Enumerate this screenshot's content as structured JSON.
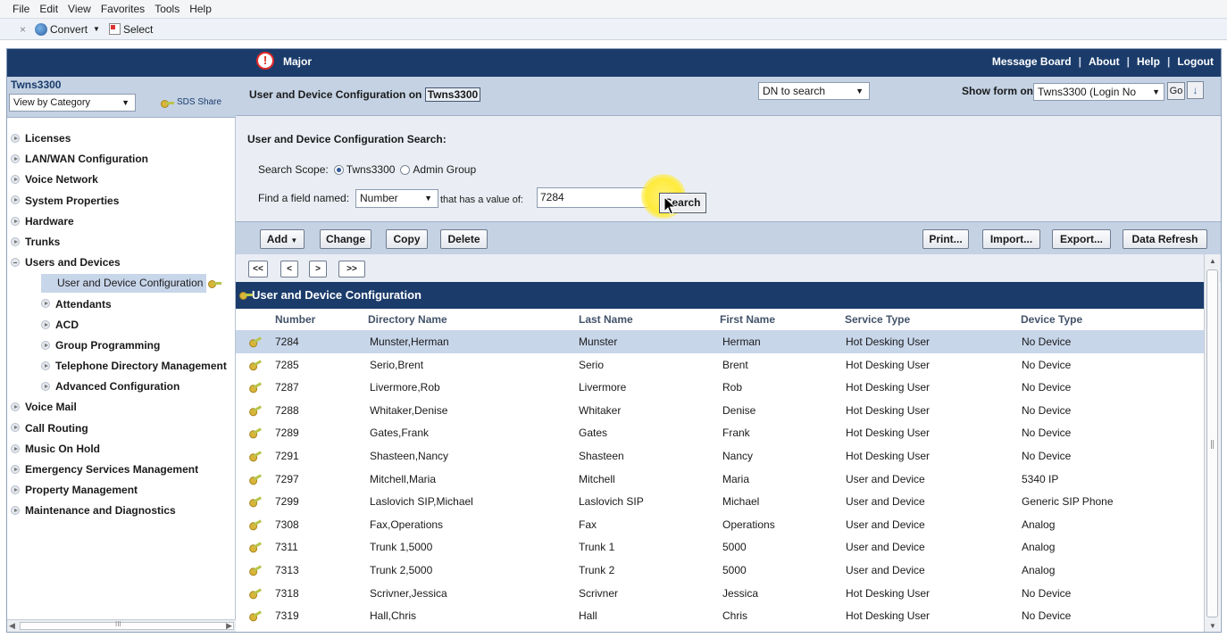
{
  "browser": {
    "menu": [
      "File",
      "Edit",
      "View",
      "Favorites",
      "Tools",
      "Help"
    ],
    "cmd": {
      "close": "×",
      "convert": "Convert",
      "select": "Select"
    }
  },
  "topbar": {
    "alarm_icon": "!",
    "alarm_level": "Major",
    "links": [
      "Message Board",
      "About",
      "Help",
      "Logout"
    ],
    "sep": "|"
  },
  "left": {
    "system_name": "Twns3300",
    "view_select": "View by Category",
    "sds_share": "SDS Share",
    "nav": [
      {
        "label": "Licenses",
        "level": 1
      },
      {
        "label": "LAN/WAN Configuration",
        "level": 1
      },
      {
        "label": "Voice Network",
        "level": 1
      },
      {
        "label": "System Properties",
        "level": 1
      },
      {
        "label": "Hardware",
        "level": 1
      },
      {
        "label": "Trunks",
        "level": 1
      },
      {
        "label": "Users and Devices",
        "level": 1,
        "open": true
      },
      {
        "label": "User and Device Configuration",
        "level": 2,
        "selected": true
      },
      {
        "label": "Attendants",
        "level": 2
      },
      {
        "label": "ACD",
        "level": 2
      },
      {
        "label": "Group Programming",
        "level": 2
      },
      {
        "label": "Telephone Directory Management",
        "level": 2
      },
      {
        "label": "Advanced Configuration",
        "level": 2
      },
      {
        "label": "Voice Mail",
        "level": 1
      },
      {
        "label": "Call Routing",
        "level": 1
      },
      {
        "label": "Music On Hold",
        "level": 1
      },
      {
        "label": "Emergency Services Management",
        "level": 1
      },
      {
        "label": "Property Management",
        "level": 1
      },
      {
        "label": "Maintenance and Diagnostics",
        "level": 1
      }
    ],
    "hscroll_grip": "III"
  },
  "header": {
    "title_prefix": "User and Device Configuration on",
    "title_system": "Twns3300",
    "dn_select": "DN to search",
    "show_form_label": "Show form on",
    "show_form_select": "Twns3300 (Login No",
    "go": "Go"
  },
  "search": {
    "title": "User and Device Configuration  Search:",
    "scope_label": "Search Scope:",
    "scope_options": [
      "Twns3300",
      "Admin Group"
    ],
    "find_label": "Find a field named:",
    "field_select": "Number",
    "has_value_label": "that has a value of:",
    "value": "7284",
    "button": "Search"
  },
  "toolbar": {
    "add": "Add",
    "change": "Change",
    "copy": "Copy",
    "delete": "Delete",
    "print": "Print...",
    "import": "Import...",
    "export": "Export...",
    "refresh": "Data Refresh"
  },
  "pager": [
    "<<",
    "<",
    ">",
    ">>"
  ],
  "grid": {
    "title": "User and Device Configuration",
    "columns": [
      "Number",
      "Directory Name",
      "Last Name",
      "First Name",
      "Service Type",
      "Device Type"
    ],
    "rows": [
      [
        "7284",
        "Munster,Herman",
        "Munster",
        "Herman",
        "Hot Desking User",
        "No Device"
      ],
      [
        "7285",
        "Serio,Brent",
        "Serio",
        "Brent",
        "Hot Desking User",
        "No Device"
      ],
      [
        "7287",
        "Livermore,Rob",
        "Livermore",
        "Rob",
        "Hot Desking User",
        "No Device"
      ],
      [
        "7288",
        "Whitaker,Denise",
        "Whitaker",
        "Denise",
        "Hot Desking User",
        "No Device"
      ],
      [
        "7289",
        "Gates,Frank",
        "Gates",
        "Frank",
        "Hot Desking User",
        "No Device"
      ],
      [
        "7291",
        "Shasteen,Nancy",
        "Shasteen",
        "Nancy",
        "Hot Desking User",
        "No Device"
      ],
      [
        "7297",
        "Mitchell,Maria",
        "Mitchell",
        "Maria",
        "User and Device",
        "5340 IP"
      ],
      [
        "7299",
        "Laslovich SIP,Michael",
        "Laslovich SIP",
        "Michael",
        "User and Device",
        "Generic SIP Phone"
      ],
      [
        "7308",
        "Fax,Operations",
        "Fax",
        "Operations",
        "User and Device",
        "Analog"
      ],
      [
        "7311",
        "Trunk 1,5000",
        "Trunk 1",
        "5000",
        "User and Device",
        "Analog"
      ],
      [
        "7313",
        "Trunk 2,5000",
        "Trunk 2",
        "5000",
        "User and Device",
        "Analog"
      ],
      [
        "7318",
        "Scrivner,Jessica",
        "Scrivner",
        "Jessica",
        "Hot Desking User",
        "No Device"
      ],
      [
        "7319",
        "Hall,Chris",
        "Hall",
        "Chris",
        "Hot Desking User",
        "No Device"
      ]
    ],
    "selected_row": 0
  },
  "colors": {
    "navy": "#1b3c6b",
    "panel_blue": "#c4d2e4",
    "selected": "#c8d6ea",
    "alarm_red": "#e12a2a"
  }
}
